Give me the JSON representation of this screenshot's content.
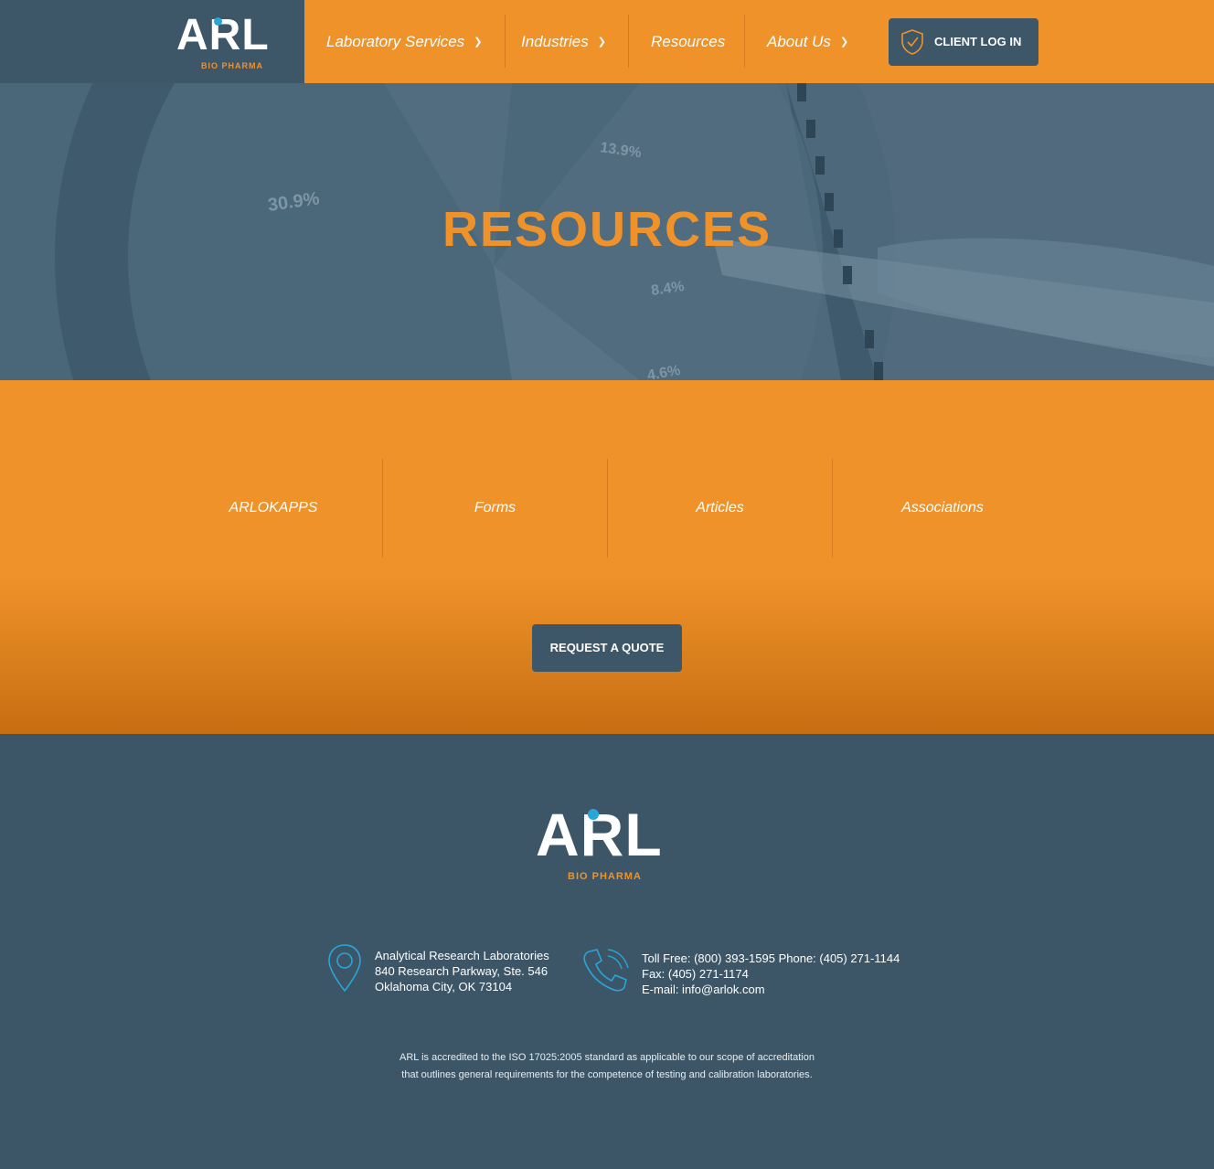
{
  "brand": {
    "logo_text": "ARL",
    "logo_subtitle": "BIO PHARMA",
    "accent_color": "#f0922a",
    "navy_color": "#3d5668",
    "dot_color": "#29a6d8"
  },
  "nav": {
    "items": [
      {
        "label": "Laboratory Services",
        "chevron": "chevron-down-icon"
      },
      {
        "label": "Industries",
        "chevron": "chevron-down-icon"
      },
      {
        "label": "Resources"
      },
      {
        "label": "About Us",
        "chevron": "chevron-down-icon"
      }
    ],
    "client_login": "CLIENT LOG IN",
    "client_icon": "shield-check-icon"
  },
  "hero": {
    "title": "RESOURCES",
    "bg_labels": [
      "13.9%",
      "30.9%",
      "8.4%",
      "4.6%"
    ]
  },
  "resources": {
    "items": [
      "ARLOKAPPS",
      "Forms",
      "Articles",
      "Associations"
    ],
    "quote_button": "REQUEST A QUOTE"
  },
  "footer": {
    "address": {
      "icon": "map-pin-icon",
      "lines": [
        "Analytical Research Laboratories",
        "840 Research Parkway, Ste. 546",
        "Oklahoma City, OK 73104"
      ]
    },
    "contact": {
      "icon": "phone-icon",
      "lines": [
        "Toll Free: (800) 393-1595 Phone: (405) 271-1144",
        "Fax: (405) 271-1174",
        "E-mail: info@arlok.com"
      ]
    },
    "accreditation": [
      "ARL is accredited to the ISO 17025:2005 standard as applicable to our scope of accreditation",
      "that outlines general requirements for the competence of testing and calibration laboratories."
    ]
  }
}
